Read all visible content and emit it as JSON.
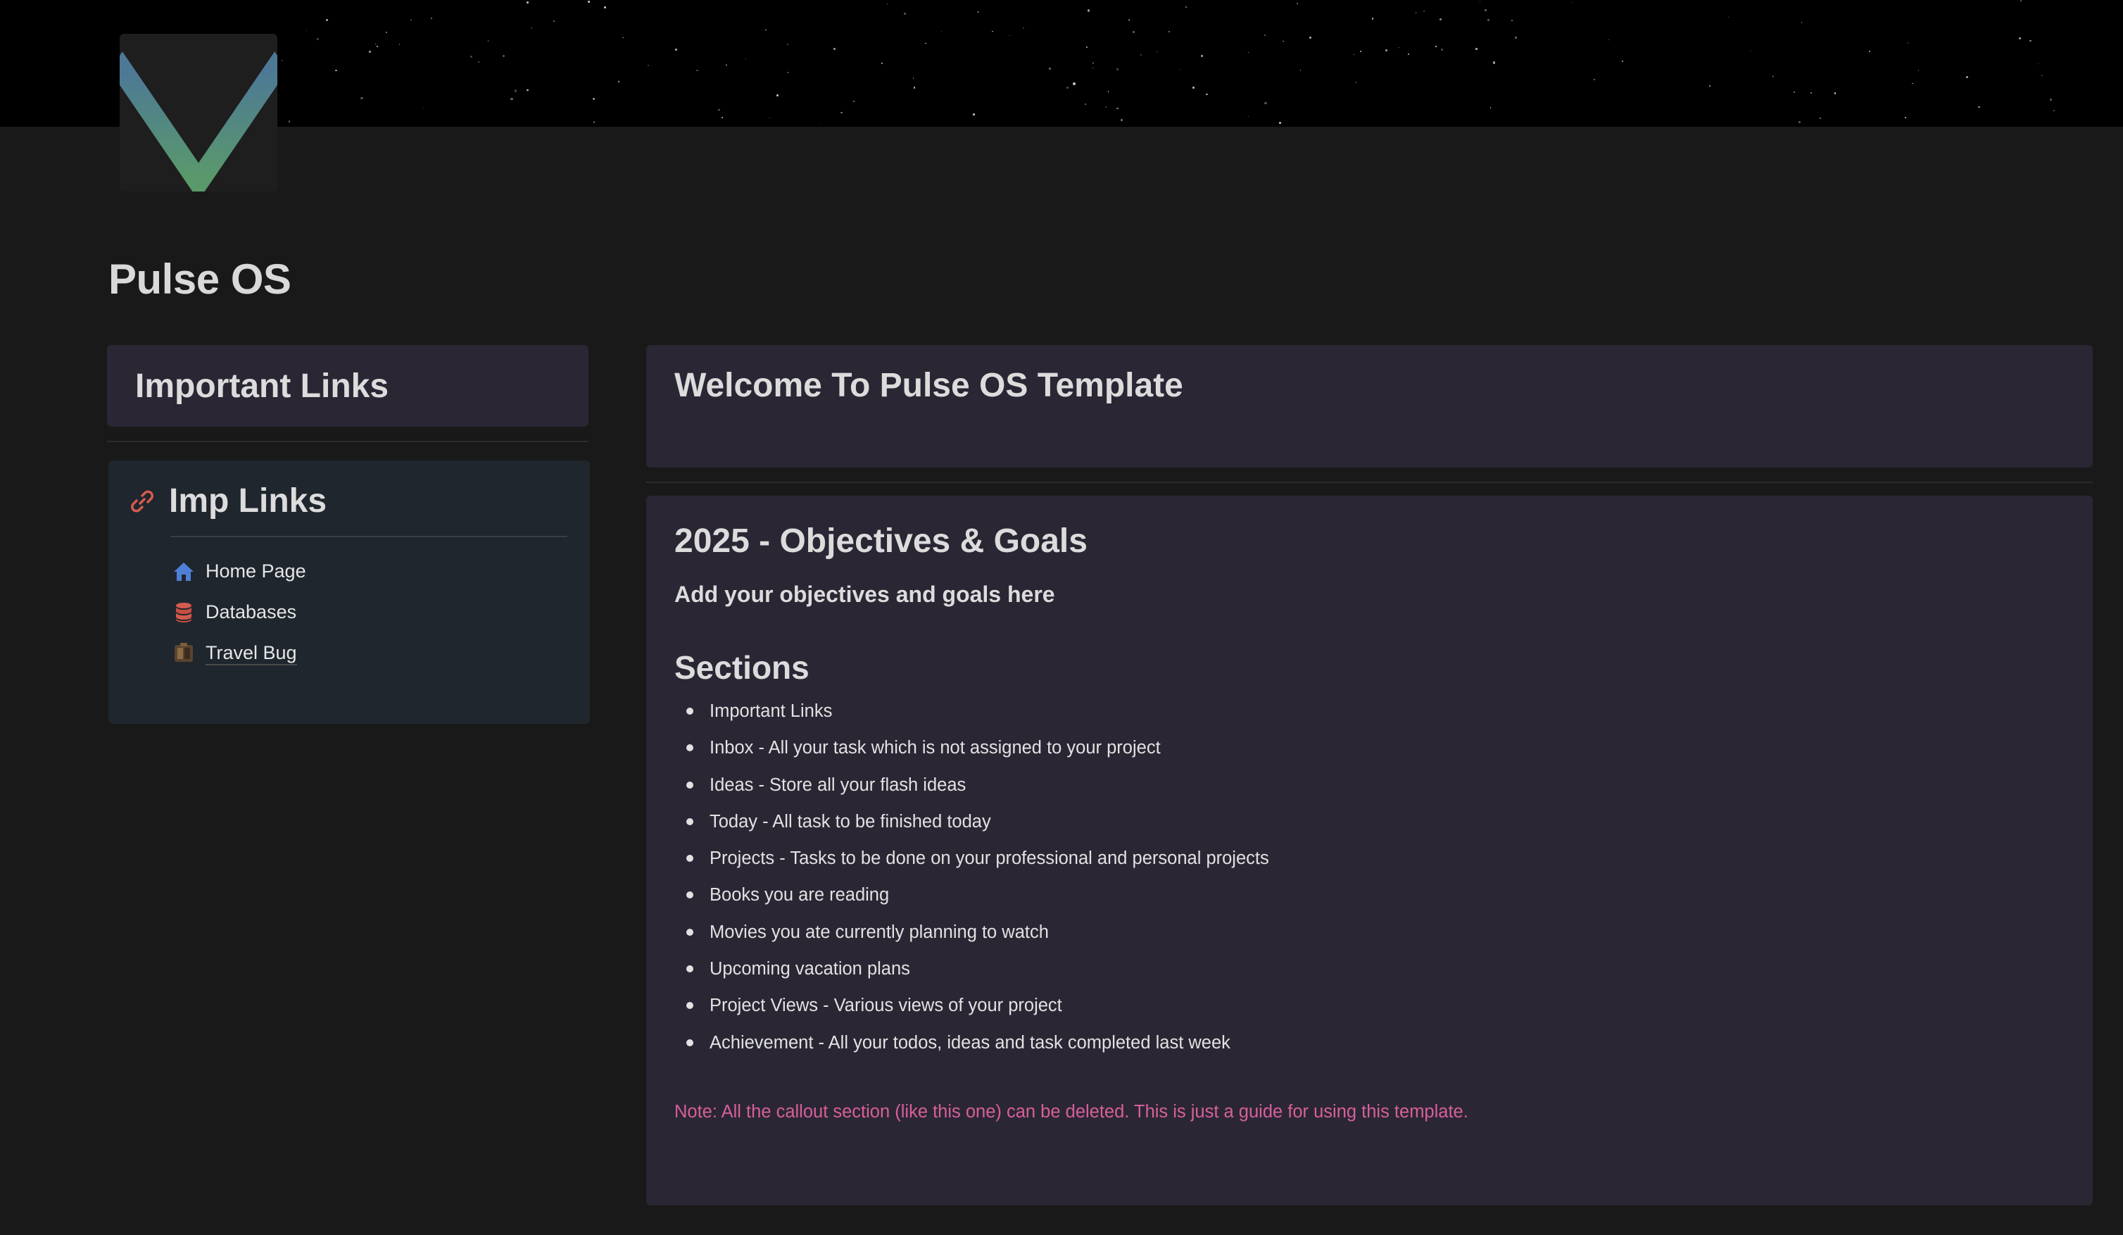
{
  "page": {
    "title": "Pulse OS",
    "icon": "pulse-chevron-logo",
    "cover": "starfield-cover"
  },
  "left": {
    "heading": "Important Links",
    "imp_links": {
      "title": "Imp Links",
      "icon": "link-chain-icon",
      "items": [
        {
          "label": "Home Page",
          "icon": "house-icon"
        },
        {
          "label": "Databases",
          "icon": "database-icon"
        },
        {
          "label": "Travel Bug",
          "icon": "travel-bug-icon"
        }
      ]
    }
  },
  "right": {
    "welcome": "Welcome To Pulse OS Template",
    "goals": {
      "title": "2025 -  Objectives & Goals",
      "subtitle": "Add your objectives and goals here",
      "sections_title": "Sections",
      "sections": [
        "Important Links",
        "Inbox - All your task which is not assigned to your project",
        "Ideas - Store all your flash ideas",
        "Today - All task to be finished today",
        "Projects - Tasks to be done on your professional and personal projects",
        "Books  you are reading",
        "Movies you ate currently planning to watch",
        "Upcoming vacation plans",
        "Project Views - Various views of your project",
        "Achievement - All your todos, ideas and task completed last week"
      ],
      "note": "Note: All the callout section (like this one) can be deleted. This is just a guide for using this template."
    }
  },
  "colors": {
    "background": "#191919",
    "callout_purple": "#2b2634",
    "callout_blue": "#1f262d",
    "note_pink": "#d6609a",
    "link_red": "#d45b4f"
  }
}
